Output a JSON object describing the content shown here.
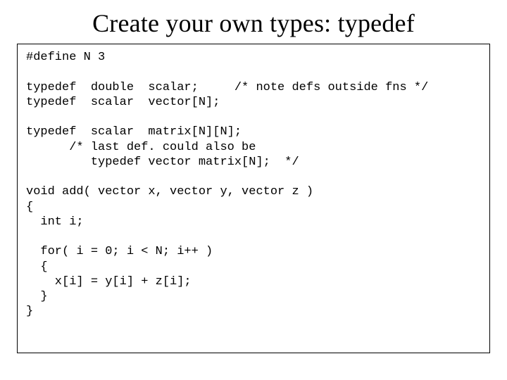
{
  "title": "Create your own types: typedef",
  "codeLines": [
    "#define N 3",
    "",
    "typedef  double  scalar;     /* note defs outside fns */",
    "typedef  scalar  vector[N];",
    "",
    "typedef  scalar  matrix[N][N];",
    "      /* last def. could also be",
    "         typedef vector matrix[N];  */",
    "",
    "void add( vector x, vector y, vector z )",
    "{",
    "  int i;",
    "",
    "  for( i = 0; i < N; i++ )",
    "  {",
    "    x[i] = y[i] + z[i];",
    "  }",
    "}"
  ]
}
